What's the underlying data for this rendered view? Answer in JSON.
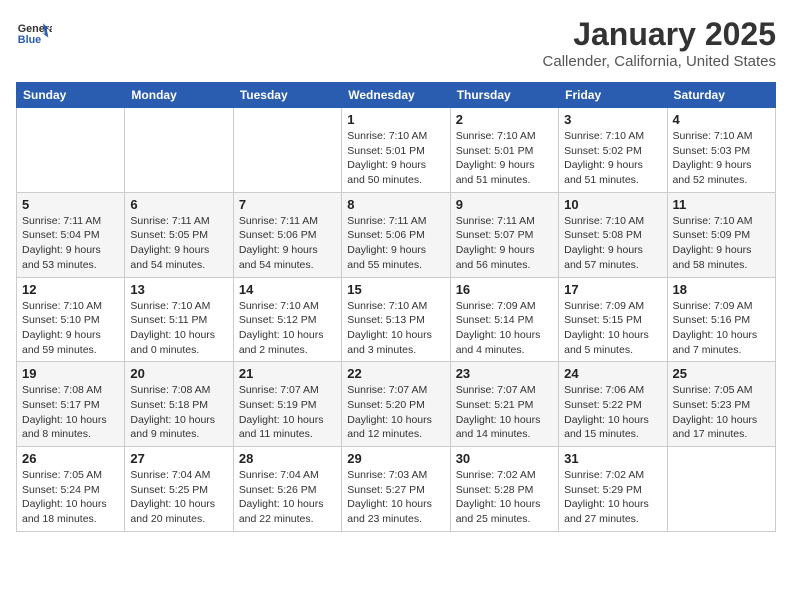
{
  "header": {
    "logo_line1": "General",
    "logo_line2": "Blue",
    "month": "January 2025",
    "location": "Callender, California, United States"
  },
  "days_of_week": [
    "Sunday",
    "Monday",
    "Tuesday",
    "Wednesday",
    "Thursday",
    "Friday",
    "Saturday"
  ],
  "weeks": [
    [
      {
        "day": "",
        "info": ""
      },
      {
        "day": "",
        "info": ""
      },
      {
        "day": "",
        "info": ""
      },
      {
        "day": "1",
        "info": "Sunrise: 7:10 AM\nSunset: 5:01 PM\nDaylight: 9 hours\nand 50 minutes."
      },
      {
        "day": "2",
        "info": "Sunrise: 7:10 AM\nSunset: 5:01 PM\nDaylight: 9 hours\nand 51 minutes."
      },
      {
        "day": "3",
        "info": "Sunrise: 7:10 AM\nSunset: 5:02 PM\nDaylight: 9 hours\nand 51 minutes."
      },
      {
        "day": "4",
        "info": "Sunrise: 7:10 AM\nSunset: 5:03 PM\nDaylight: 9 hours\nand 52 minutes."
      }
    ],
    [
      {
        "day": "5",
        "info": "Sunrise: 7:11 AM\nSunset: 5:04 PM\nDaylight: 9 hours\nand 53 minutes."
      },
      {
        "day": "6",
        "info": "Sunrise: 7:11 AM\nSunset: 5:05 PM\nDaylight: 9 hours\nand 54 minutes."
      },
      {
        "day": "7",
        "info": "Sunrise: 7:11 AM\nSunset: 5:06 PM\nDaylight: 9 hours\nand 54 minutes."
      },
      {
        "day": "8",
        "info": "Sunrise: 7:11 AM\nSunset: 5:06 PM\nDaylight: 9 hours\nand 55 minutes."
      },
      {
        "day": "9",
        "info": "Sunrise: 7:11 AM\nSunset: 5:07 PM\nDaylight: 9 hours\nand 56 minutes."
      },
      {
        "day": "10",
        "info": "Sunrise: 7:10 AM\nSunset: 5:08 PM\nDaylight: 9 hours\nand 57 minutes."
      },
      {
        "day": "11",
        "info": "Sunrise: 7:10 AM\nSunset: 5:09 PM\nDaylight: 9 hours\nand 58 minutes."
      }
    ],
    [
      {
        "day": "12",
        "info": "Sunrise: 7:10 AM\nSunset: 5:10 PM\nDaylight: 9 hours\nand 59 minutes."
      },
      {
        "day": "13",
        "info": "Sunrise: 7:10 AM\nSunset: 5:11 PM\nDaylight: 10 hours\nand 0 minutes."
      },
      {
        "day": "14",
        "info": "Sunrise: 7:10 AM\nSunset: 5:12 PM\nDaylight: 10 hours\nand 2 minutes."
      },
      {
        "day": "15",
        "info": "Sunrise: 7:10 AM\nSunset: 5:13 PM\nDaylight: 10 hours\nand 3 minutes."
      },
      {
        "day": "16",
        "info": "Sunrise: 7:09 AM\nSunset: 5:14 PM\nDaylight: 10 hours\nand 4 minutes."
      },
      {
        "day": "17",
        "info": "Sunrise: 7:09 AM\nSunset: 5:15 PM\nDaylight: 10 hours\nand 5 minutes."
      },
      {
        "day": "18",
        "info": "Sunrise: 7:09 AM\nSunset: 5:16 PM\nDaylight: 10 hours\nand 7 minutes."
      }
    ],
    [
      {
        "day": "19",
        "info": "Sunrise: 7:08 AM\nSunset: 5:17 PM\nDaylight: 10 hours\nand 8 minutes."
      },
      {
        "day": "20",
        "info": "Sunrise: 7:08 AM\nSunset: 5:18 PM\nDaylight: 10 hours\nand 9 minutes."
      },
      {
        "day": "21",
        "info": "Sunrise: 7:07 AM\nSunset: 5:19 PM\nDaylight: 10 hours\nand 11 minutes."
      },
      {
        "day": "22",
        "info": "Sunrise: 7:07 AM\nSunset: 5:20 PM\nDaylight: 10 hours\nand 12 minutes."
      },
      {
        "day": "23",
        "info": "Sunrise: 7:07 AM\nSunset: 5:21 PM\nDaylight: 10 hours\nand 14 minutes."
      },
      {
        "day": "24",
        "info": "Sunrise: 7:06 AM\nSunset: 5:22 PM\nDaylight: 10 hours\nand 15 minutes."
      },
      {
        "day": "25",
        "info": "Sunrise: 7:05 AM\nSunset: 5:23 PM\nDaylight: 10 hours\nand 17 minutes."
      }
    ],
    [
      {
        "day": "26",
        "info": "Sunrise: 7:05 AM\nSunset: 5:24 PM\nDaylight: 10 hours\nand 18 minutes."
      },
      {
        "day": "27",
        "info": "Sunrise: 7:04 AM\nSunset: 5:25 PM\nDaylight: 10 hours\nand 20 minutes."
      },
      {
        "day": "28",
        "info": "Sunrise: 7:04 AM\nSunset: 5:26 PM\nDaylight: 10 hours\nand 22 minutes."
      },
      {
        "day": "29",
        "info": "Sunrise: 7:03 AM\nSunset: 5:27 PM\nDaylight: 10 hours\nand 23 minutes."
      },
      {
        "day": "30",
        "info": "Sunrise: 7:02 AM\nSunset: 5:28 PM\nDaylight: 10 hours\nand 25 minutes."
      },
      {
        "day": "31",
        "info": "Sunrise: 7:02 AM\nSunset: 5:29 PM\nDaylight: 10 hours\nand 27 minutes."
      },
      {
        "day": "",
        "info": ""
      }
    ]
  ]
}
